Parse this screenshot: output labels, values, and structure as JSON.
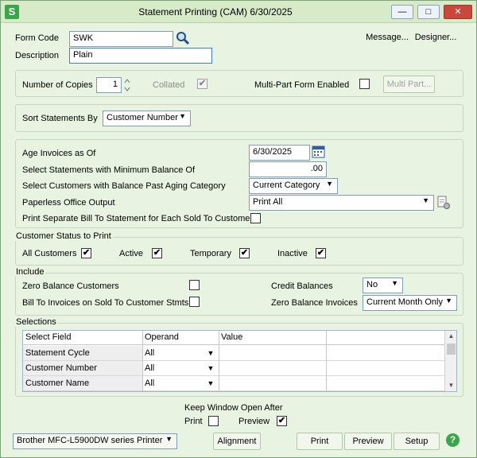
{
  "window": {
    "title": "Statement Printing (CAM) 6/30/2025",
    "app_icon": "S",
    "controls": {
      "minimize": "—",
      "maximize": "□",
      "close": "✕"
    }
  },
  "form": {
    "form_code_label": "Form Code",
    "form_code_value": "SWK",
    "description_label": "Description",
    "description_value": "Plain",
    "message_button": "Message...",
    "designer_button": "Designer..."
  },
  "copies": {
    "copies_label": "Number of Copies",
    "copies_value": "1",
    "collated_label": "Collated",
    "collated_checked": "✔",
    "multipart_label": "Multi-Part Form Enabled",
    "multipart_button": "Multi Part..."
  },
  "sort": {
    "label": "Sort Statements By",
    "value": "Customer Number"
  },
  "criteria": {
    "age_label": "Age Invoices as Of",
    "age_value": "6/30/2025",
    "min_balance_label": "Select Statements with Minimum Balance Of",
    "min_balance_value": ".00",
    "past_aging_label": "Select Customers with Balance Past Aging Category",
    "past_aging_value": "Current Category",
    "paperless_label": "Paperless Office Output",
    "paperless_value": "Print All",
    "separate_bill_label": "Print Separate Bill To Statement for Each Sold To Customer"
  },
  "status": {
    "section_title": "Customer Status to Print",
    "all_label": "All Customers",
    "active_label": "Active",
    "temporary_label": "Temporary",
    "inactive_label": "Inactive",
    "check_mark": "✔"
  },
  "include": {
    "section_title": "Include",
    "zero_balance_label": "Zero Balance Customers",
    "bill_to_label": "Bill To Invoices on Sold To Customer Stmts",
    "credit_label": "Credit Balances",
    "credit_value": "No",
    "zero_invoices_label": "Zero Balance Invoices",
    "zero_invoices_value": "Current Month Only"
  },
  "selections": {
    "section_title": "Selections",
    "columns": [
      "Select Field",
      "Operand",
      "Value"
    ],
    "rows": [
      {
        "field": "Statement Cycle",
        "operand": "All"
      },
      {
        "field": "Customer Number",
        "operand": "All"
      },
      {
        "field": "Customer Name",
        "operand": "All"
      }
    ]
  },
  "footer": {
    "keep_open_label": "Keep Window Open After",
    "print_label": "Print",
    "preview_label": "Preview",
    "preview_checked": "✔",
    "printer_value": "Brother MFC-L5900DW series Printer",
    "alignment_button": "Alignment",
    "print_button": "Print",
    "preview_button": "Preview",
    "setup_button": "Setup",
    "help_icon": "?"
  },
  "colors": {
    "background": "#e8f3e1",
    "titlebar": "#d7ebc9",
    "close_button": "#c9483b",
    "help_icon": "#3aa64a"
  }
}
